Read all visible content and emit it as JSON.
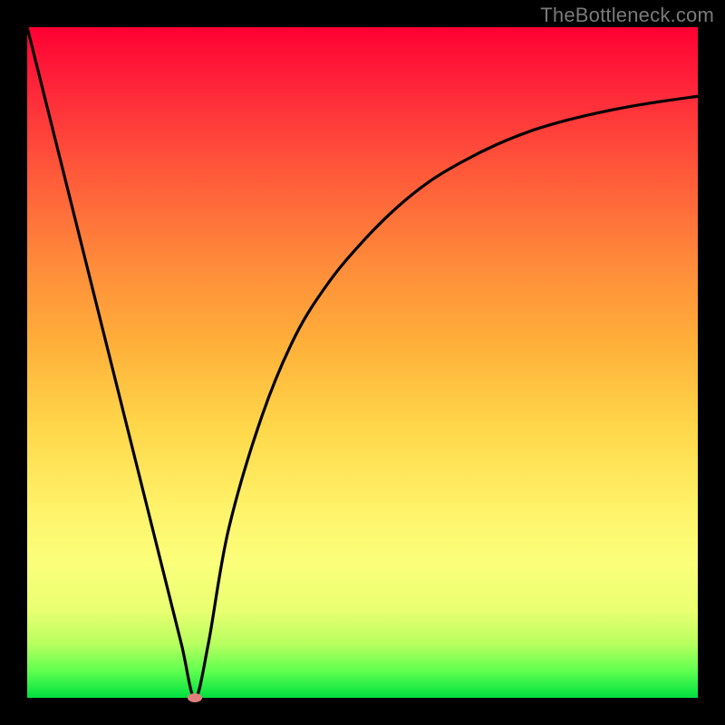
{
  "attribution": "TheBottleneck.com",
  "chart_data": {
    "type": "line",
    "title": "",
    "xlabel": "",
    "ylabel": "",
    "xlim": [
      0,
      100
    ],
    "ylim": [
      0,
      100
    ],
    "series": [
      {
        "name": "bottleneck-curve",
        "x": [
          0,
          5,
          10,
          15,
          20,
          23,
          25,
          27,
          30,
          35,
          40,
          45,
          50,
          55,
          60,
          65,
          70,
          75,
          80,
          85,
          90,
          95,
          100
        ],
        "values": [
          100,
          80,
          60,
          40,
          20,
          8,
          0,
          8,
          25,
          42,
          54,
          62,
          68,
          73,
          77,
          80,
          82.5,
          84.5,
          86,
          87.2,
          88.2,
          89,
          89.7
        ]
      }
    ],
    "marker": {
      "x": 25,
      "y": 0
    },
    "gradient_stops": [
      {
        "pct": 0,
        "color": "#ff0033"
      },
      {
        "pct": 50,
        "color": "#ffcc33"
      },
      {
        "pct": 85,
        "color": "#f8ff66"
      },
      {
        "pct": 100,
        "color": "#00e040"
      }
    ]
  }
}
